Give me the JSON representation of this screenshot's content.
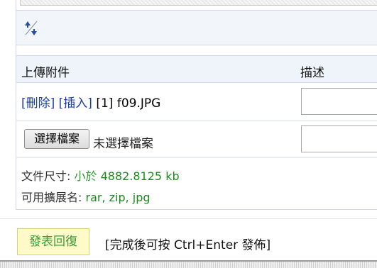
{
  "attachments": {
    "header_upload": "上傳附件",
    "header_description": "描述",
    "file_row": {
      "delete_link": "[刪除]",
      "insert_link": "[插入]",
      "file_label": "[1] f09.JPG"
    },
    "chooser": {
      "button_label": "選擇檔案",
      "status": "未選擇檔案"
    },
    "size_label": "文件尺寸: ",
    "size_prefix": "小於 ",
    "size_value": "4882.8125 kb",
    "ext_label": "可用擴展名: ",
    "ext_value": "rar, zip, jpg"
  },
  "footer": {
    "submit_label": "發表回復",
    "hint": "[完成後可按 Ctrl+Enter 發佈]"
  },
  "icons": {
    "resize": "resize-arrows-icon"
  },
  "colors": {
    "link": "#1a3ea8",
    "accent_green": "#2a9b2a",
    "submit_bg": "#fefbc8",
    "header_bg": "#eef4fa"
  }
}
